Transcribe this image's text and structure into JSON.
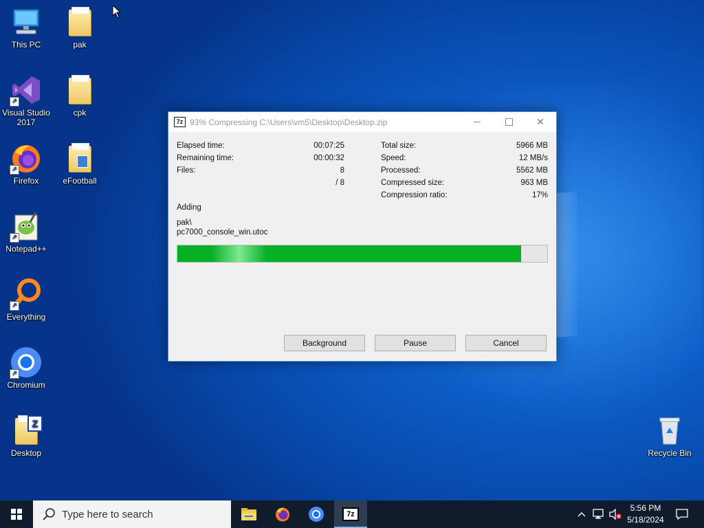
{
  "desktop": {
    "icons": [
      {
        "label": "This PC"
      },
      {
        "label": "pak"
      },
      {
        "label": "Visual Studio 2017"
      },
      {
        "label": "cpk"
      },
      {
        "label": "Firefox"
      },
      {
        "label": "eFootball"
      },
      {
        "label": "Notepad++"
      },
      {
        "label": "Everything"
      },
      {
        "label": "Chromium"
      },
      {
        "label": "Desktop"
      },
      {
        "label": "Recycle Bin"
      }
    ]
  },
  "dialog": {
    "app_icon_text": "7z",
    "title": "93% Compressing C:\\Users\\vm5\\Desktop\\Desktop.zip",
    "left_stats": [
      {
        "label": "Elapsed time:",
        "value": "00:07:25"
      },
      {
        "label": "Remaining time:",
        "value": "00:00:32"
      },
      {
        "label": "Files:",
        "value": "8"
      },
      {
        "label": "",
        "value": "/ 8"
      }
    ],
    "right_stats": [
      {
        "label": "Total size:",
        "value": "5966 MB"
      },
      {
        "label": "Speed:",
        "value": "12 MB/s"
      },
      {
        "label": "Processed:",
        "value": "5562 MB"
      },
      {
        "label": "Compressed size:",
        "value": "963 MB"
      },
      {
        "label": "Compression ratio:",
        "value": "17%"
      }
    ],
    "status": "Adding",
    "file_line1": "pak\\",
    "file_line2": "pc7000_console_win.utoc",
    "progress": 0.93,
    "buttons": {
      "background": "Background",
      "pause": "Pause",
      "cancel": "Cancel"
    }
  },
  "taskbar": {
    "search_placeholder": "Type here to search",
    "active_app_icon_text": "7z",
    "clock_time": "5:56 PM",
    "clock_date": "5/18/2024"
  },
  "colors": {
    "progress_fill": "#06b025",
    "taskbar_bg": "#101c2c",
    "desktop_blue": "#0d5ec9"
  }
}
